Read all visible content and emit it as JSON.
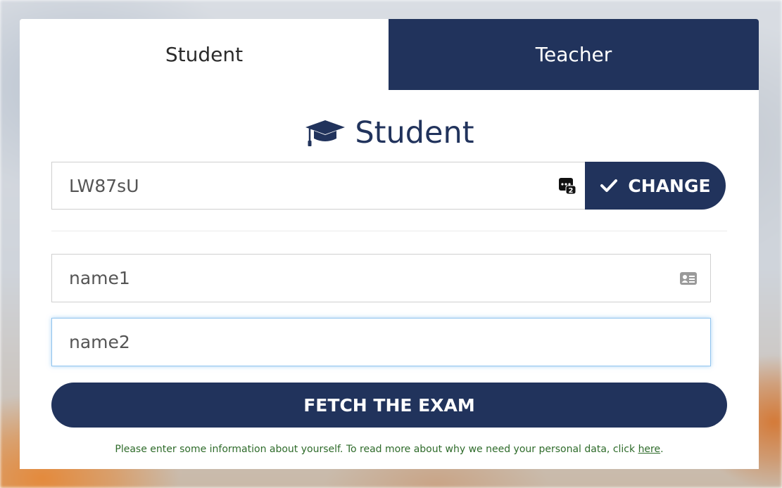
{
  "tabs": [
    {
      "label": "Student",
      "active": true
    },
    {
      "label": "Teacher",
      "active": false
    }
  ],
  "heading": {
    "icon": "graduation-cap-icon",
    "title": "Student"
  },
  "code_field": {
    "value": "LW87sU",
    "icon": "code-icon"
  },
  "change_button": {
    "label": "CHANGE",
    "icon": "check-icon"
  },
  "first_name": {
    "value": "name1",
    "icon": "id-card-icon"
  },
  "last_name": {
    "value": "name2"
  },
  "fetch_button": {
    "label": "FETCH THE EXAM"
  },
  "note": {
    "text": "Please enter some information about yourself. To read more about why we need your personal data, click ",
    "link": "here",
    "suffix": "."
  },
  "colors": {
    "primary": "#21335c",
    "note_text": "#2e6b2a",
    "focus_border": "#8fc3ee"
  }
}
